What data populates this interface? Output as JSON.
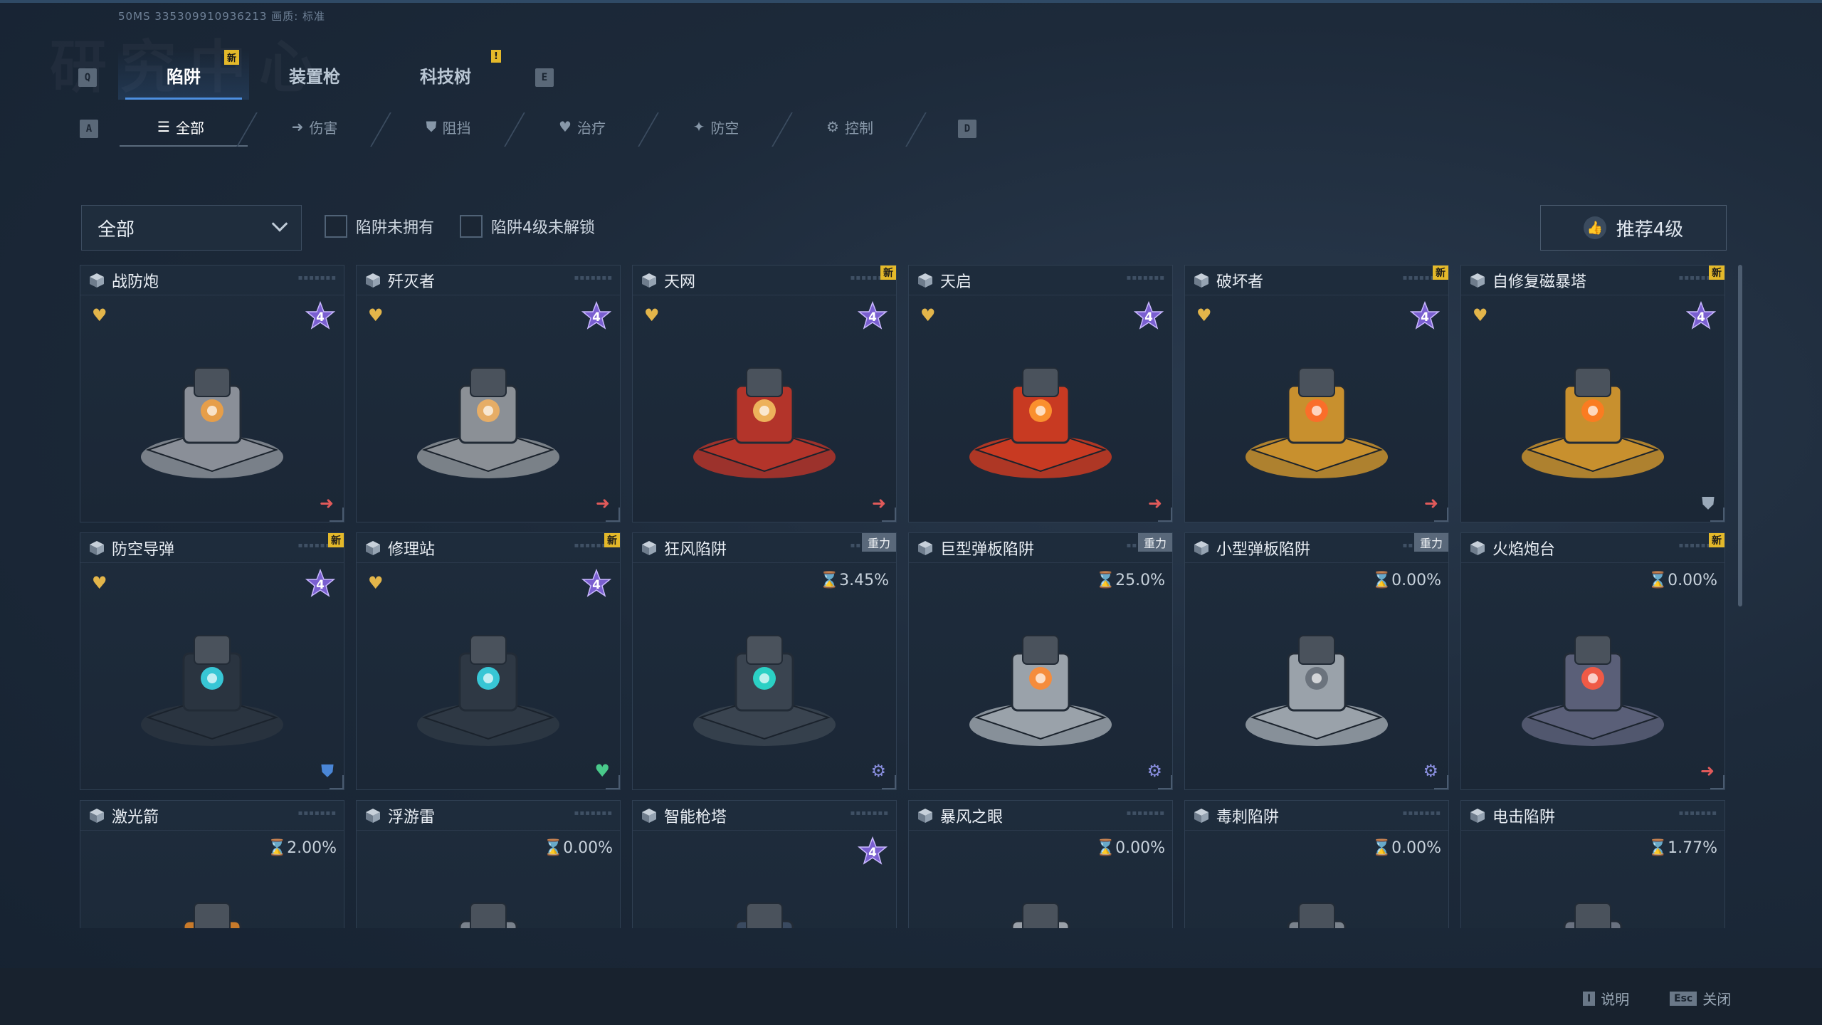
{
  "sysinfo": "50MS  335309910936213    画质: 标准",
  "bg_title": "研究中心",
  "keys": {
    "q": "Q",
    "e": "E",
    "a": "A",
    "d": "D"
  },
  "main_tabs": [
    {
      "label": "陷阱",
      "badge": "新",
      "active": true
    },
    {
      "label": "装置枪",
      "badge": "",
      "active": false
    },
    {
      "label": "科技树",
      "badge": "!",
      "active": false
    }
  ],
  "sub_tabs": [
    {
      "label": "全部",
      "icon": "list-icon",
      "active": true
    },
    {
      "label": "伤害",
      "icon": "arrow-icon"
    },
    {
      "label": "阻挡",
      "icon": "shield-icon"
    },
    {
      "label": "治疗",
      "icon": "heart-icon"
    },
    {
      "label": "防空",
      "icon": "antiair-icon"
    },
    {
      "label": "控制",
      "icon": "gear-icon"
    }
  ],
  "filter": {
    "dropdown_value": "全部",
    "check1": "陷阱未拥有",
    "check2": "陷阱4级未解锁",
    "recommend": "推荐4级"
  },
  "cards": [
    {
      "name": "战防炮",
      "badge": "",
      "fav": true,
      "level": "4",
      "rate": "",
      "corner": "damage",
      "color": "#8a8f98",
      "accent": "#f0a040"
    },
    {
      "name": "歼灭者",
      "badge": "",
      "fav": true,
      "level": "4",
      "rate": "",
      "corner": "damage",
      "color": "#8b9096",
      "accent": "#f0b060"
    },
    {
      "name": "天网",
      "badge": "新",
      "fav": true,
      "level": "4",
      "rate": "",
      "corner": "damage",
      "color": "#b3342a",
      "accent": "#f3c060"
    },
    {
      "name": "天启",
      "badge": "",
      "fav": true,
      "level": "4",
      "rate": "",
      "corner": "damage",
      "color": "#c83a22",
      "accent": "#ff9a30"
    },
    {
      "name": "破坏者",
      "badge": "新",
      "fav": true,
      "level": "4",
      "rate": "",
      "corner": "damage",
      "color": "#c8902e",
      "accent": "#ff6a2a"
    },
    {
      "name": "自修复磁暴塔",
      "badge": "新",
      "fav": true,
      "level": "4",
      "rate": "",
      "corner": "block",
      "color": "#c8902e",
      "accent": "#ff7a20"
    },
    {
      "name": "防空导弹",
      "badge": "新",
      "fav": true,
      "level": "4",
      "rate": "",
      "corner": "antiair",
      "color": "#2a3440",
      "accent": "#3ad6e6"
    },
    {
      "name": "修理站",
      "badge": "新",
      "fav": true,
      "level": "4",
      "rate": "",
      "corner": "heal",
      "color": "#2e3844",
      "accent": "#3ad6e6"
    },
    {
      "name": "狂风陷阱",
      "badge": "重力",
      "fav": false,
      "level": "",
      "rate": "3.45%",
      "corner": "control",
      "color": "#3a4450",
      "accent": "#2ae0d0"
    },
    {
      "name": "巨型弹板陷阱",
      "badge": "重力",
      "fav": false,
      "level": "",
      "rate": "25.0%",
      "corner": "control",
      "color": "#9aa2aa",
      "accent": "#ff8a30"
    },
    {
      "name": "小型弹板陷阱",
      "badge": "重力",
      "fav": false,
      "level": "",
      "rate": "0.00%",
      "corner": "control",
      "color": "#9aa2aa",
      "accent": "#666e78"
    },
    {
      "name": "火焰炮台",
      "badge": "新",
      "fav": false,
      "level": "",
      "rate": "0.00%",
      "corner": "damage",
      "color": "#5a5f78",
      "accent": "#ff5a40"
    },
    {
      "name": "激光箭",
      "badge": "",
      "fav": false,
      "level": "",
      "rate": "2.00%",
      "corner": "",
      "color": "#c87a2a",
      "accent": "#ff9a30"
    },
    {
      "name": "浮游雷",
      "badge": "",
      "fav": false,
      "level": "",
      "rate": "0.00%",
      "corner": "",
      "color": "#7a828c",
      "accent": "#aab2ba"
    },
    {
      "name": "智能枪塔",
      "badge": "",
      "fav": false,
      "level": "4",
      "rate": "",
      "corner": "",
      "color": "#3a4a60",
      "accent": "#4aa0ff"
    },
    {
      "name": "暴风之眼",
      "badge": "",
      "fav": false,
      "level": "",
      "rate": "0.00%",
      "corner": "",
      "color": "#9aa0a8",
      "accent": "#c0c6cc"
    },
    {
      "name": "毒刺陷阱",
      "badge": "",
      "fav": false,
      "level": "",
      "rate": "0.00%",
      "corner": "",
      "color": "#7a828c",
      "accent": "#9aa2aa"
    },
    {
      "name": "电击陷阱",
      "badge": "",
      "fav": false,
      "level": "",
      "rate": "1.77%",
      "corner": "",
      "color": "#6a7280",
      "accent": "#4aa0ff"
    }
  ],
  "bottom": {
    "help_key": "I",
    "help": "说明",
    "close_key": "Esc",
    "close": "关闭"
  }
}
